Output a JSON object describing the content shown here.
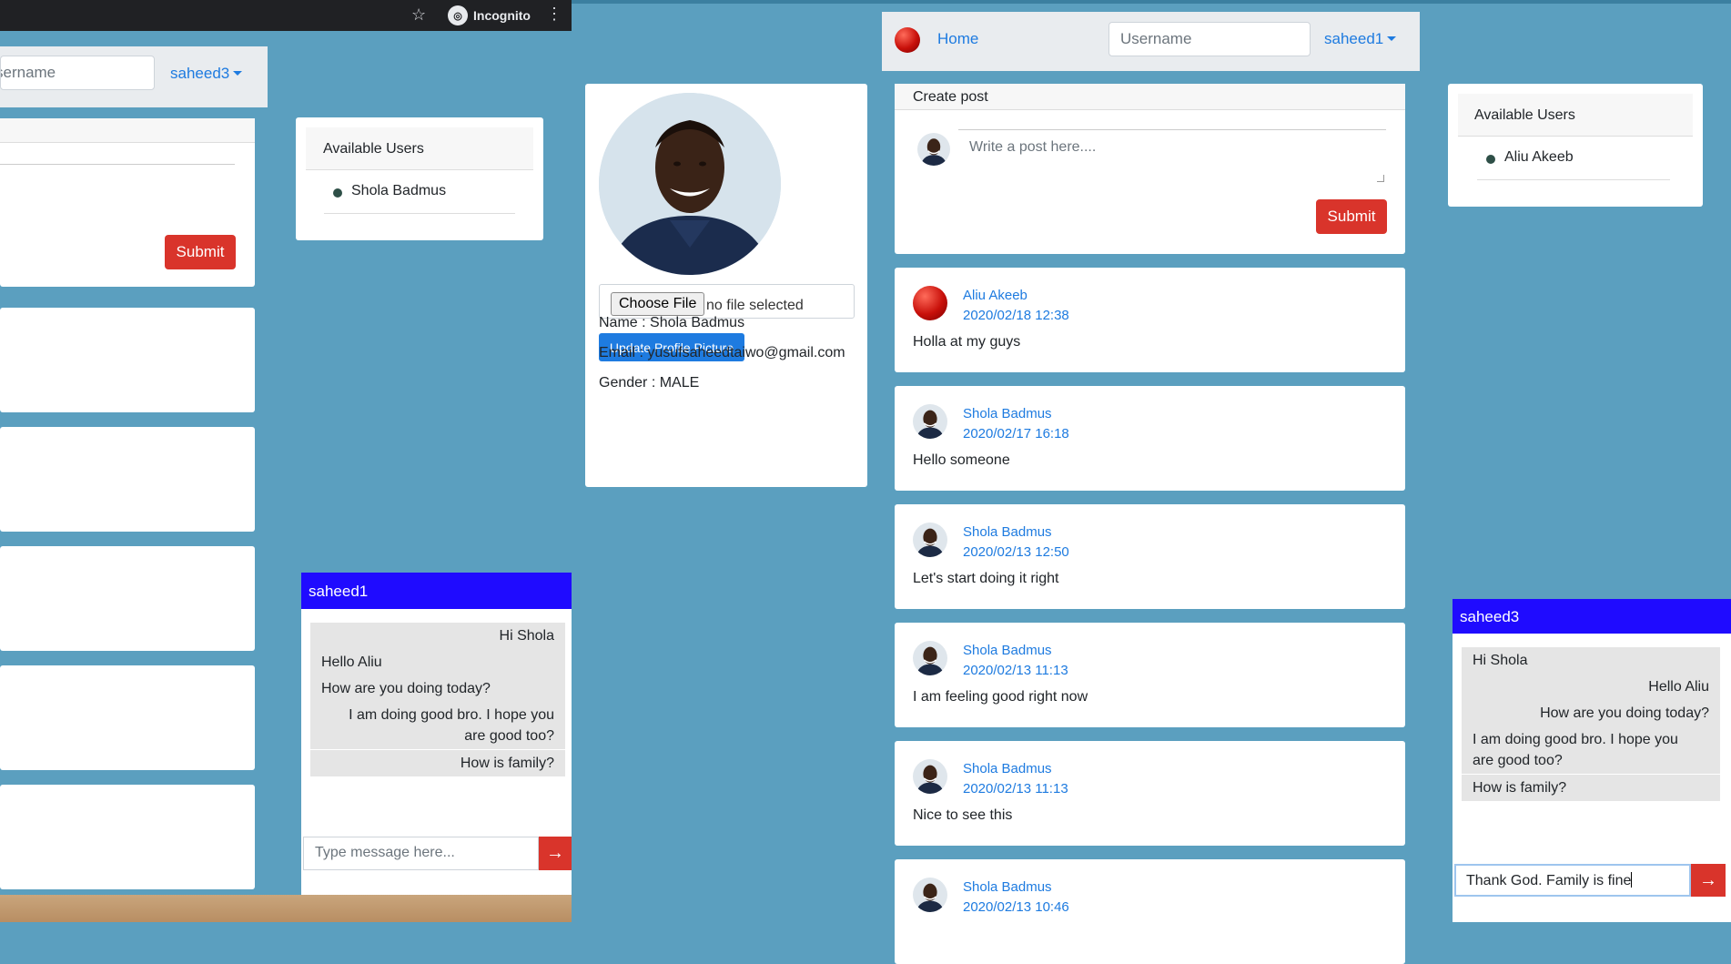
{
  "back_window": {
    "chrome": {
      "incognito_label": "Incognito"
    },
    "nav": {
      "username_placeholder": "sername",
      "user_menu": "saheed3"
    },
    "create_post": {
      "submit_label": "Submit"
    },
    "available_users": {
      "title": "Available Users",
      "users": [
        "Shola Badmus"
      ]
    },
    "chat": {
      "title": "saheed1",
      "messages": [
        {
          "text": "Hi Shola",
          "align": "right"
        },
        {
          "text": "Hello Aliu",
          "align": "left"
        },
        {
          "text": "How are you doing today?",
          "align": "left"
        },
        {
          "text": "I am doing good bro. I hope you are good too?",
          "align": "right"
        },
        {
          "text": "How is family?",
          "align": "right"
        }
      ],
      "input_placeholder": "Type message here..."
    }
  },
  "front_window": {
    "nav": {
      "home_label": "Home",
      "username_placeholder": "Username",
      "user_menu": "saheed1"
    },
    "profile": {
      "choose_file_label": "Choose File",
      "file_status": "no file selected",
      "update_button": "Update Profile Picture",
      "name_line": "Name : Shola Badmus",
      "email_line": "Email : yusufsaheedtaiwo@gmail.com",
      "gender_line": "Gender : MALE"
    },
    "create_post": {
      "title": "Create post",
      "placeholder": "Write a post here....",
      "submit_label": "Submit"
    },
    "feed": [
      {
        "author": "Aliu Akeeb",
        "date": "2020/02/18 12:38",
        "text": "Holla at my guys",
        "avatar": "red-ball"
      },
      {
        "author": "Shola Badmus",
        "date": "2020/02/17 16:18",
        "text": "Hello someone",
        "avatar": "photo"
      },
      {
        "author": "Shola Badmus",
        "date": "2020/02/13 12:50",
        "text": "Let's start doing it right",
        "avatar": "photo"
      },
      {
        "author": "Shola Badmus",
        "date": "2020/02/13 11:13",
        "text": "I am feeling good right now",
        "avatar": "photo"
      },
      {
        "author": "Shola Badmus",
        "date": "2020/02/13 11:13",
        "text": "Nice to see this",
        "avatar": "photo"
      },
      {
        "author": "Shola Badmus",
        "date": "2020/02/13 10:46",
        "text": "",
        "avatar": "photo"
      }
    ],
    "available_users": {
      "title": "Available Users",
      "users": [
        "Aliu Akeeb"
      ]
    },
    "chat": {
      "title": "saheed3",
      "messages": [
        {
          "text": "Hi Shola",
          "align": "left"
        },
        {
          "text": "Hello Aliu",
          "align": "right"
        },
        {
          "text": "How are you doing today?",
          "align": "right"
        },
        {
          "text": "I am doing good bro. I hope you are good too?",
          "align": "left"
        },
        {
          "text": "How is family?",
          "align": "left"
        }
      ],
      "input_value": "Thank God. Family is fine"
    }
  },
  "colors": {
    "accent": "#1e7be0",
    "danger": "#d9342b",
    "chat_header": "#1f0bff",
    "page_bg": "#5b9fbf"
  }
}
